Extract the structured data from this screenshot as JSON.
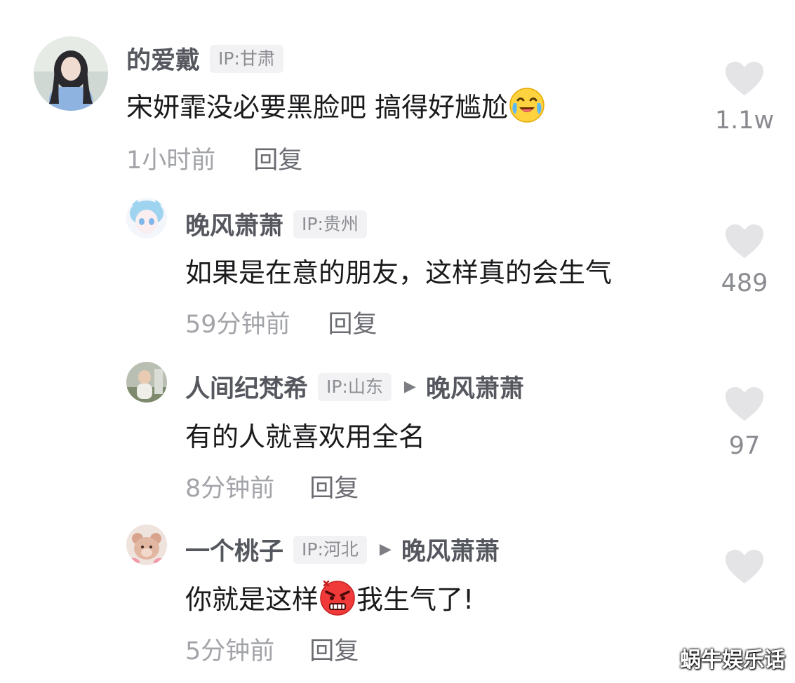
{
  "comments": [
    {
      "name": "的爱戴",
      "ip": "IP:甘肃",
      "text": "宋妍霏没必要黑脸吧 搞得好尴尬",
      "emoji": "crying-laughing-emoji",
      "time": "1小时前",
      "reply": "回复",
      "likes": "1.1w"
    },
    {
      "name": "晚风萧萧",
      "ip": "IP:贵州",
      "text": "如果是在意的朋友，这样真的会生气",
      "time": "59分钟前",
      "reply": "回复",
      "likes": "489"
    },
    {
      "name": "人间纪梵希",
      "ip": "IP:山东",
      "reply_to": "晚风萧萧",
      "text": "有的人就喜欢用全名",
      "time": "8分钟前",
      "reply": "回复",
      "likes": "97"
    },
    {
      "name": "一个桃子",
      "ip": "IP:河北",
      "reply_to": "晚风萧萧",
      "text_before": "你就是这样",
      "emoji": "angry-face-emoji",
      "text_after": "我生气了!",
      "time": "5分钟前",
      "reply": "回复",
      "likes": ""
    }
  ],
  "arrow_glyph": "▶",
  "watermark": "蜗牛娱乐话",
  "colors": {
    "name": "#55575e",
    "text": "#1a1a1c",
    "time": "#a3a4a9",
    "heart": "#e4e4e7"
  }
}
